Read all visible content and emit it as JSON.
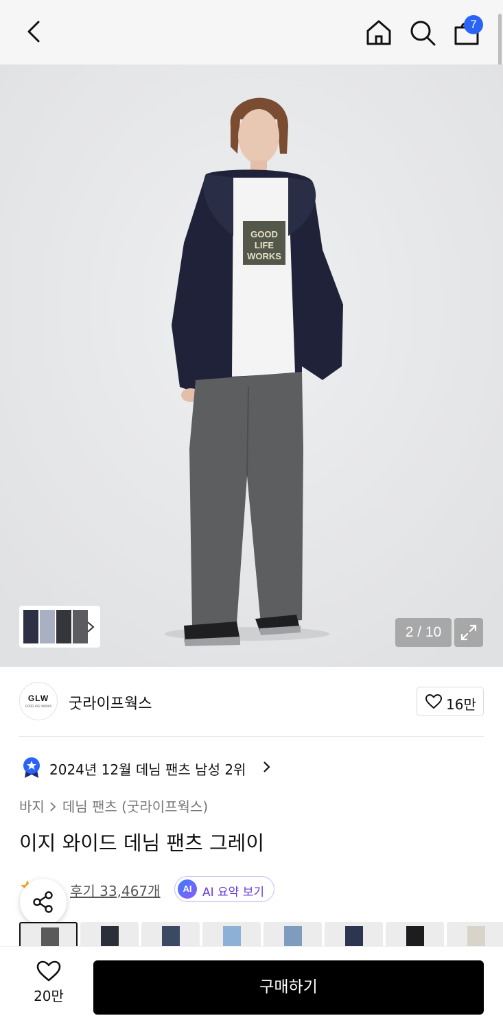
{
  "top_bar": {
    "cart_count": "7"
  },
  "gallery": {
    "counter": "2 / 10",
    "graphic_text": [
      "GOOD",
      "LIFE",
      "WORKS"
    ]
  },
  "brand": {
    "logo_text": "GLW",
    "logo_subtext": "GOOD LIFE WORKS",
    "name": "굿라이프웍스",
    "likes": "16만"
  },
  "ranking": {
    "text": "2024년 12월 데님 팬츠 남성 2위"
  },
  "breadcrumb": {
    "level1": "바지",
    "level2": "데님 팬츠 (굿라이프웍스)"
  },
  "product": {
    "title": "이지 와이드 데님 팬츠 그레이"
  },
  "reviews": {
    "label": "후기 33,467개",
    "ai_badge": "AI",
    "ai_label": "AI 요약 보기"
  },
  "color_options": [
    {
      "name": "gray",
      "color": "#5a5a5a",
      "selected": true
    },
    {
      "name": "black",
      "color": "#2b2f3a"
    },
    {
      "name": "dark-blue",
      "color": "#3a4a63"
    },
    {
      "name": "light-blue",
      "color": "#8db0d6"
    },
    {
      "name": "mid-blue",
      "color": "#7f9bbd"
    },
    {
      "name": "indigo",
      "color": "#2d3650"
    },
    {
      "name": "black-2",
      "color": "#1d1d1f"
    },
    {
      "name": "ivory",
      "color": "#d8d4c9"
    }
  ],
  "bottom_bar": {
    "wishlist_count": "20만",
    "buy_label": "구매하기"
  },
  "colors": {
    "accent": "#2a64f6",
    "ai_purple": "#6a3fd9",
    "buy_bg": "#000000"
  }
}
